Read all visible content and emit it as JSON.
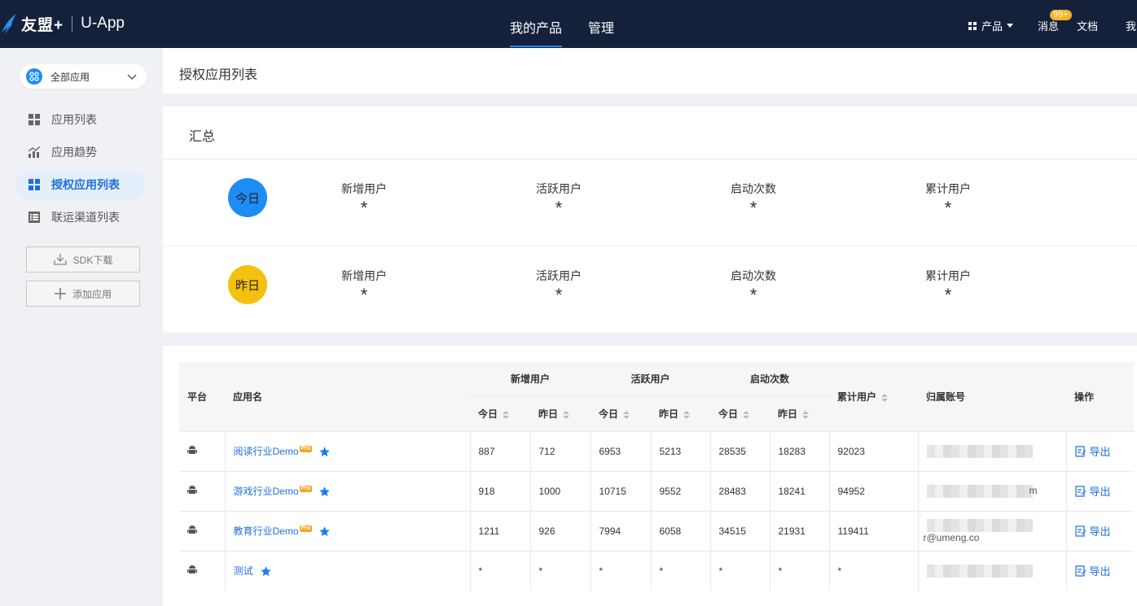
{
  "topbar": {
    "brand": "友盟+",
    "app": "U-App",
    "nav": [
      "我的产品",
      "管理"
    ],
    "products": "产品",
    "messages": "消息",
    "message_badge": "99+",
    "docs": "文档",
    "me": "我"
  },
  "sidebar": {
    "app_select": "全部应用",
    "items": [
      {
        "label": "应用列表",
        "icon": "grid-icon"
      },
      {
        "label": "应用趋势",
        "icon": "trend-icon"
      },
      {
        "label": "授权应用列表",
        "icon": "grid-icon",
        "active": true
      },
      {
        "label": "联运渠道列表",
        "icon": "list-icon"
      }
    ],
    "sdk_download": "SDK下载",
    "add_app": "添加应用"
  },
  "page": {
    "title": "授权应用列表",
    "summary_title": "汇总",
    "summary_rows": [
      {
        "label": "今日",
        "color": "#1e8cf5",
        "values": [
          "*",
          "*",
          "*",
          "*"
        ]
      },
      {
        "label": "昨日",
        "color": "#f5c10f",
        "values": [
          "*",
          "*",
          "*",
          "*"
        ]
      }
    ],
    "metric_headers": [
      "新增用户",
      "活跃用户",
      "启动次数",
      "累计用户"
    ]
  },
  "table": {
    "headers": {
      "platform": "平台",
      "app_name": "应用名",
      "new_users": "新增用户",
      "active_users": "活跃用户",
      "launches": "启动次数",
      "total_users": "累计用户",
      "account": "归属账号",
      "action": "操作",
      "today": "今日",
      "yesterday": "昨日"
    },
    "rows": [
      {
        "name": "阅读行业Demo",
        "pro": "Pro",
        "new_today": "887",
        "new_yest": "712",
        "act_today": "6953",
        "act_yest": "5213",
        "launch_today": "28535",
        "launch_yest": "18283",
        "total": "92023",
        "account": "",
        "action": "导出"
      },
      {
        "name": "游戏行业Demo",
        "pro": "Pro",
        "new_today": "918",
        "new_yest": "1000",
        "act_today": "10715",
        "act_yest": "9552",
        "launch_today": "28483",
        "launch_yest": "18241",
        "total": "94952",
        "account": "m",
        "action": "导出"
      },
      {
        "name": "教育行业Demo",
        "pro": "Pro",
        "new_today": "1211",
        "new_yest": "926",
        "act_today": "7994",
        "act_yest": "6058",
        "launch_today": "34515",
        "launch_yest": "21931",
        "total": "119411",
        "account": "r@umeng.co",
        "action": "导出"
      },
      {
        "name": "测试",
        "pro": "",
        "new_today": "*",
        "new_yest": "*",
        "act_today": "*",
        "act_yest": "*",
        "launch_today": "*",
        "launch_yest": "*",
        "total": "*",
        "account": "",
        "action": "导出"
      }
    ]
  },
  "colors": {
    "accent": "#1e8cf5",
    "topbar": "#15203a",
    "today": "#1e8cf5",
    "yesterday": "#f5c10f"
  }
}
